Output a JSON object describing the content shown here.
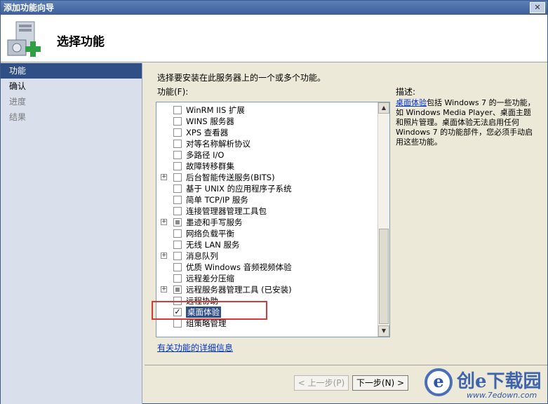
{
  "window": {
    "title": "添加功能向导",
    "close_glyph": "✕"
  },
  "header": {
    "title": "选择功能",
    "icon": "server-add-icon"
  },
  "nav": {
    "items": [
      {
        "label": "功能",
        "state": "active"
      },
      {
        "label": "确认",
        "state": "normal"
      },
      {
        "label": "进度",
        "state": "disabled"
      },
      {
        "label": "结果",
        "state": "disabled"
      }
    ]
  },
  "main": {
    "intro": "选择要安装在此服务器上的一个或多个功能。",
    "features_label": "功能(F):",
    "description_label": "描述:",
    "description_link": "桌面体验",
    "description_text": "包括 Windows 7 的一些功能，如 Windows Media Player、桌面主题和照片管理。桌面体验无法启用任何 Windows 7 的功能部件，您必须手动启用这些功能。",
    "more_link": "有关功能的详细信息"
  },
  "features": [
    {
      "label": "WinRM IIS 扩展",
      "expander": "",
      "check": ""
    },
    {
      "label": "WINS 服务器",
      "expander": "",
      "check": ""
    },
    {
      "label": "XPS 查看器",
      "expander": "",
      "check": ""
    },
    {
      "label": "对等名称解析协议",
      "expander": "",
      "check": ""
    },
    {
      "label": "多路径 I/O",
      "expander": "",
      "check": ""
    },
    {
      "label": "故障转移群集",
      "expander": "",
      "check": ""
    },
    {
      "label": "后台智能传送服务(BITS)",
      "expander": "+",
      "check": ""
    },
    {
      "label": "基于 UNIX 的应用程序子系统",
      "expander": "",
      "check": ""
    },
    {
      "label": "简单 TCP/IP 服务",
      "expander": "",
      "check": ""
    },
    {
      "label": "连接管理器管理工具包",
      "expander": "",
      "check": ""
    },
    {
      "label": "墨迹和手写服务",
      "expander": "+",
      "check": "partial"
    },
    {
      "label": "网络负载平衡",
      "expander": "",
      "check": ""
    },
    {
      "label": "无线 LAN 服务",
      "expander": "",
      "check": ""
    },
    {
      "label": "消息队列",
      "expander": "+",
      "check": ""
    },
    {
      "label": "优质 Windows 音频视频体验",
      "expander": "",
      "check": ""
    },
    {
      "label": "远程差分压缩",
      "expander": "",
      "check": ""
    },
    {
      "label": "远程服务器管理工具  (已安装)",
      "expander": "+",
      "check": "partial"
    },
    {
      "label": "远程协助",
      "expander": "",
      "check": ""
    },
    {
      "label": "桌面体验",
      "expander": "",
      "check": "✓",
      "selected": true
    },
    {
      "label": "组策略管理",
      "expander": "",
      "check": ""
    }
  ],
  "scrollbar": {
    "up_glyph": "▲",
    "down_glyph": "▼"
  },
  "buttons": {
    "prev": "< 上一步(P)",
    "next": "下一步(N) >"
  },
  "watermark": {
    "logo_letter": "e",
    "text": "创e下载园",
    "url": "www.7edown.com"
  }
}
